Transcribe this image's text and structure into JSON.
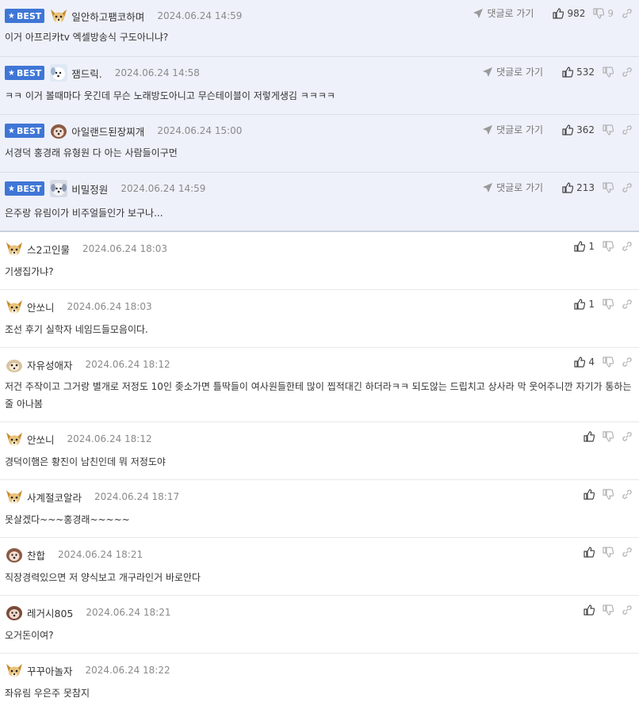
{
  "reply_label": "댓글로 가기",
  "best_label": "BEST",
  "best_comments": [
    {
      "nick": "일안하고팸코하며",
      "date": "2024.06.24 14:59",
      "text": "이거 아프리카tv 엑셀방송식 구도아니냐?",
      "likes": "982",
      "dislikes": "9"
    },
    {
      "nick": "잼드릭.",
      "date": "2024.06.24 14:58",
      "text": "ㅋㅋ 이거 볼때마다 웃긴데 무슨 노래방도아니고 무슨테이블이 저렇게생김 ㅋㅋㅋㅋ",
      "likes": "532",
      "dislikes": ""
    },
    {
      "nick": "아일랜드된장찌개",
      "date": "2024.06.24 15:00",
      "text": "서경덕 홍경래 유형원 다 아는 사람들이구먼",
      "likes": "362",
      "dislikes": ""
    },
    {
      "nick": "비밀정원",
      "date": "2024.06.24 14:59",
      "text": "은주랑 유림이가 비주얼들인가 보구나...",
      "likes": "213",
      "dislikes": ""
    }
  ],
  "comments": [
    {
      "nick": "스2고인물",
      "date": "2024.06.24 18:03",
      "text": "기생집가냐?",
      "likes": "1"
    },
    {
      "nick": "안쏘니",
      "date": "2024.06.24 18:03",
      "text": "조선 후기 실학자 네임드들모음이다.",
      "likes": "1"
    },
    {
      "nick": "자유성애자",
      "date": "2024.06.24 18:12",
      "text": "저건 주작이고 그거랑 별개로 저정도 10인 좆소가면 틀딱들이 여사원들한테 많이 찝적대긴 하더라ㅋㅋ 되도않는 드립치고 상사라 막 웃어주니깐 자기가 통하는 줄 아나봄",
      "likes": "4"
    },
    {
      "nick": "안쏘니",
      "date": "2024.06.24 18:12",
      "text": "경덕이햄은 황진이 남친인데 뭐 저정도야",
      "likes": ""
    },
    {
      "nick": "사계절코알라",
      "date": "2024.06.24 18:17",
      "text": "못살겠다~~~홍경래~~~~~",
      "likes": ""
    },
    {
      "nick": "찬합",
      "date": "2024.06.24 18:21",
      "text": "직장경력있으면 저 양식보고 개구라인거 바로안다",
      "likes": ""
    },
    {
      "nick": "레거시805",
      "date": "2024.06.24 18:21",
      "text": "오거돈이여?",
      "likes": ""
    },
    {
      "nick": "꾸꾸아놀자",
      "date": "2024.06.24 18:22",
      "text": "좌유림 우은주 못참지",
      "likes": ""
    }
  ]
}
